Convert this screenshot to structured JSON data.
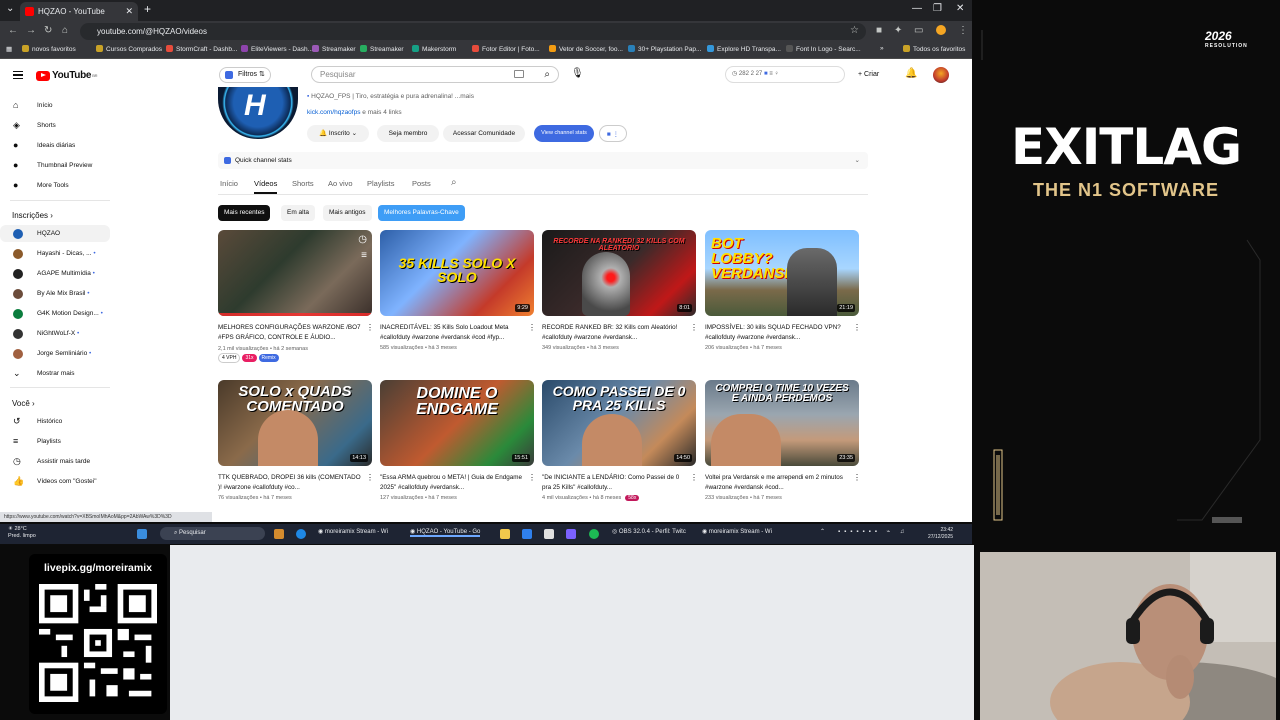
{
  "browser": {
    "tab_title": "HQZAO - YouTube",
    "url": "youtube.com/@HQZAO/videos",
    "bookmarks": [
      "novos favoritos",
      "Cursos Comprados",
      "StormCraft - Dashb...",
      "EliteViewers - Dash...",
      "Streamaker",
      "Streamaker",
      "Makerstorm",
      "Fotor Editor | Foto...",
      "Vetor de Soccer, foo...",
      "30+ Playstation Pap...",
      "Explore HD Transpa...",
      "Font In Logo - Searc..."
    ],
    "bookmarks_all": "Todos os favoritos",
    "status_url": "https://www.youtube.com/watch?v=XBSmoIMhAoM&pp=2AbWAw%3D%3D"
  },
  "youtube": {
    "logo": "YouTube",
    "logo_region": "BR",
    "filter_label": "Filtros",
    "search_placeholder": "Pesquisar",
    "stats_text": "282  2  27",
    "create_label": "Criar"
  },
  "sidebar": {
    "main": [
      {
        "label": "Início",
        "icon": "home-icon"
      },
      {
        "label": "Shorts",
        "icon": "shorts-icon"
      },
      {
        "label": "Ideais diárias",
        "icon": "ideas-icon"
      },
      {
        "label": "Thumbnail Preview",
        "icon": "thumbnail-icon"
      },
      {
        "label": "More Tools",
        "icon": "tools-icon"
      }
    ],
    "subs_header": "Inscrições",
    "subs": [
      {
        "label": "HQZAO",
        "color": "#1e5fb3"
      },
      {
        "label": "Hayashi - Dicas, ...",
        "color": "#8b5a2b"
      },
      {
        "label": "AGAPE Multimídia",
        "color": "#222222"
      },
      {
        "label": "By Ale Mix Brasil",
        "color": "#6b4c3b"
      },
      {
        "label": "G4K Motion Design...",
        "color": "#0b7d3e"
      },
      {
        "label": "NiGhtWoLf-X",
        "color": "#333333"
      },
      {
        "label": "Jorge Semliniário",
        "color": "#a06040"
      },
      {
        "label": "Mostrar mais",
        "color": ""
      }
    ],
    "you_header": "Você",
    "you": [
      {
        "label": "Histórico",
        "icon": "history-icon"
      },
      {
        "label": "Playlists",
        "icon": "playlist-icon"
      },
      {
        "label": "Assistir mais tarde",
        "icon": "clock-icon"
      },
      {
        "label": "Vídeos com \"Gostei\"",
        "icon": "like-icon"
      }
    ]
  },
  "channel": {
    "description": "HQZAO_FPS | Tiro, estratégia e pura adrenalina! ...mais",
    "link": "kick.com/hqzaofps",
    "link_more": " e mais 4 links",
    "subscribed": "Inscrito",
    "join": "Seja membro",
    "community": "Acessar Comunidade",
    "view_stats": "View channel stats",
    "quick_stats": "Quick channel stats",
    "tabs": [
      "Início",
      "Vídeos",
      "Shorts",
      "Ao vivo",
      "Playlists",
      "Posts"
    ],
    "chips": [
      "Mais recentes",
      "Em alta",
      "Mais antigos",
      "Melhores Palavras-Chave"
    ]
  },
  "videos": [
    {
      "title": "MELHORES CONFIGURAÇÕES WARZONE /BO7 #FPS GRÁFICO, CONTROLE E ÁUDIO...",
      "meta": "2,1 mil visualizações • há 2 semanas",
      "duration": "",
      "thumb_text": "",
      "tags": [
        "4 VPH",
        "31x",
        "Remix"
      ]
    },
    {
      "title": "INACREDITÁVEL: 35 Kills Solo Loadout Meta #callofduty #warzone #verdansk #cod #fyp...",
      "meta": "585 visualizações • há 3 meses",
      "duration": "9:29",
      "thumb_text": "35 KILLS SOLO X SOLO",
      "tags": []
    },
    {
      "title": "RECORDE RANKED BR: 32 Kills com Aleatório! #callofduty #warzone #verdansk...",
      "meta": "349 visualizações • há 3 meses",
      "duration": "8:01",
      "thumb_text": "RECORDE NA RANKED! 32 KILLS COM ALEATÓRIO",
      "tags": []
    },
    {
      "title": "IMPOSSÍVEL: 30 kills SQUAD FECHADO VPN? #callofduty #warzone #verdansk...",
      "meta": "206 visualizações • há 7 meses",
      "duration": "21:19",
      "thumb_text": "BOT LOBBY? VERDANSK",
      "tags": []
    },
    {
      "title": "TTK QUEBRADO, DROPEI 36 kills (COMENTADO )! #warzone #callofduty #co...",
      "meta": "76 visualizações • há 7 meses",
      "duration": "14:13",
      "thumb_text": "SOLO x QUADS COMENTADO",
      "tags": []
    },
    {
      "title": "\"Essa ARMA quebrou o META! | Guia de Endgame 2025\" #callofduty #verdansk...",
      "meta": "127 visualizações • há 7 meses",
      "duration": "15:51",
      "thumb_text": "DOMINE O ENDGAME",
      "tags": []
    },
    {
      "title": "\"De INICIANTE a LENDÁRIO: Como Passei de 0 pra 25 Kills\" #callofduty...",
      "meta": "4 mil visualizações • há 8 meses",
      "duration": "14:50",
      "thumb_text": "COMO PASSEI DE 0 PRA 25 KILLS",
      "tags": [
        "58x"
      ]
    },
    {
      "title": "Voltei pra Verdansk e me arrependi em 2 minutos #warzone #verdansk #cod...",
      "meta": "233 visualizações • há 7 meses",
      "duration": "23:35",
      "thumb_text": "COMPREI O TIME 10 VEZES E AINDA PERDEMOS",
      "tags": []
    }
  ],
  "taskbar": {
    "weather_temp": "28°C",
    "weather_desc": "Pred. limpo",
    "search": "Pesquisar",
    "apps": [
      "moreiramix Stream - Wi",
      "HQZAO - YouTube - Go",
      "OBS 32.0.4 - Perfil: Twitc",
      "moreiramix Stream - Wi"
    ],
    "time": "23:42",
    "date": "27/12/2025"
  },
  "overlay": {
    "exitlag": "EXITLAG",
    "exitlag_sub": "THE N1 SOFTWARE",
    "badge": "2026",
    "badge_sub": "RESOLUTION",
    "livepix": "livepix.gg/moreiramix"
  }
}
